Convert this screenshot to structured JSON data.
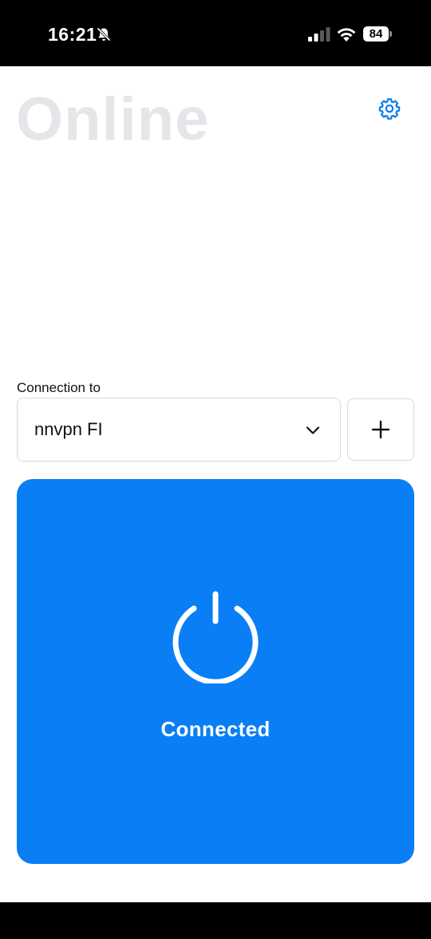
{
  "status_bar": {
    "time": "16:21",
    "battery_level": "84",
    "icons": [
      "bell-off-icon",
      "signal-icon",
      "wifi-icon",
      "battery-icon"
    ]
  },
  "header": {
    "title": "Online",
    "settings_icon": "gear-icon"
  },
  "connection": {
    "label": "Connection to",
    "selected_server": "nnvpn FI",
    "dropdown_icon": "chevron-down-icon",
    "add_icon": "plus-icon"
  },
  "connect_panel": {
    "status_text": "Connected",
    "icon": "power-icon"
  },
  "colors": {
    "accent": "#0a7ef5",
    "title_muted": "#e6e6ea",
    "border": "#d9d9dc",
    "bars": "#000000"
  }
}
